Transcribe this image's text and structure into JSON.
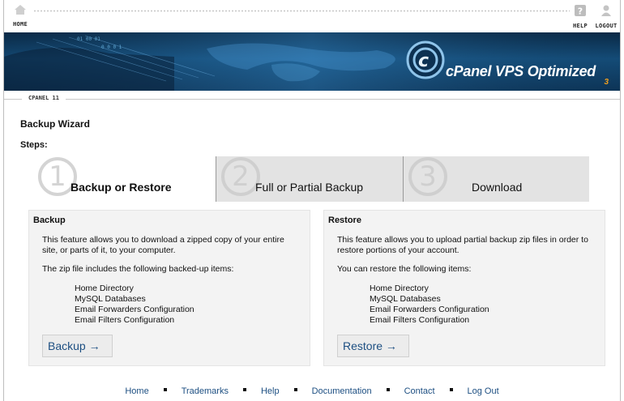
{
  "topnav": {
    "home_label": "HOME",
    "help_label": "HELP",
    "logout_label": "LOGOUT"
  },
  "banner": {
    "brand": "cPanel VPS Optimized",
    "version_num": "3"
  },
  "version_strip": "CPANEL 11",
  "page_title": "Backup Wizard",
  "steps_label": "Steps:",
  "steps": [
    {
      "num": "1",
      "label": "Backup or Restore"
    },
    {
      "num": "2",
      "label": "Full or Partial Backup"
    },
    {
      "num": "3",
      "label": "Download"
    }
  ],
  "backup_panel": {
    "heading": "Backup",
    "desc": "This feature allows you to download a zipped copy of your entire site, or parts of it, to your computer.",
    "intro": "The zip file includes the following backed-up items:",
    "items": [
      "Home Directory",
      "MySQL Databases",
      "Email Forwarders Configuration",
      "Email Filters Configuration"
    ],
    "button": "Backup →"
  },
  "restore_panel": {
    "heading": "Restore",
    "desc": "This feature allows you to upload partial backup zip files in order to restore portions of your account.",
    "intro": "You can restore the following items:",
    "items": [
      "Home Directory",
      "MySQL Databases",
      "Email Forwarders Configuration",
      "Email Filters Configuration"
    ],
    "button": "Restore →"
  },
  "footer": {
    "links": [
      "Home",
      "Trademarks",
      "Help",
      "Documentation",
      "Contact",
      "Log Out"
    ]
  },
  "colors": {
    "link": "#1d4f82",
    "panel_bg": "#f3f3f3",
    "tab_inactive": "#e3e3e3",
    "banner_dark": "#0a2945",
    "banner_accent": "#f0a020"
  }
}
